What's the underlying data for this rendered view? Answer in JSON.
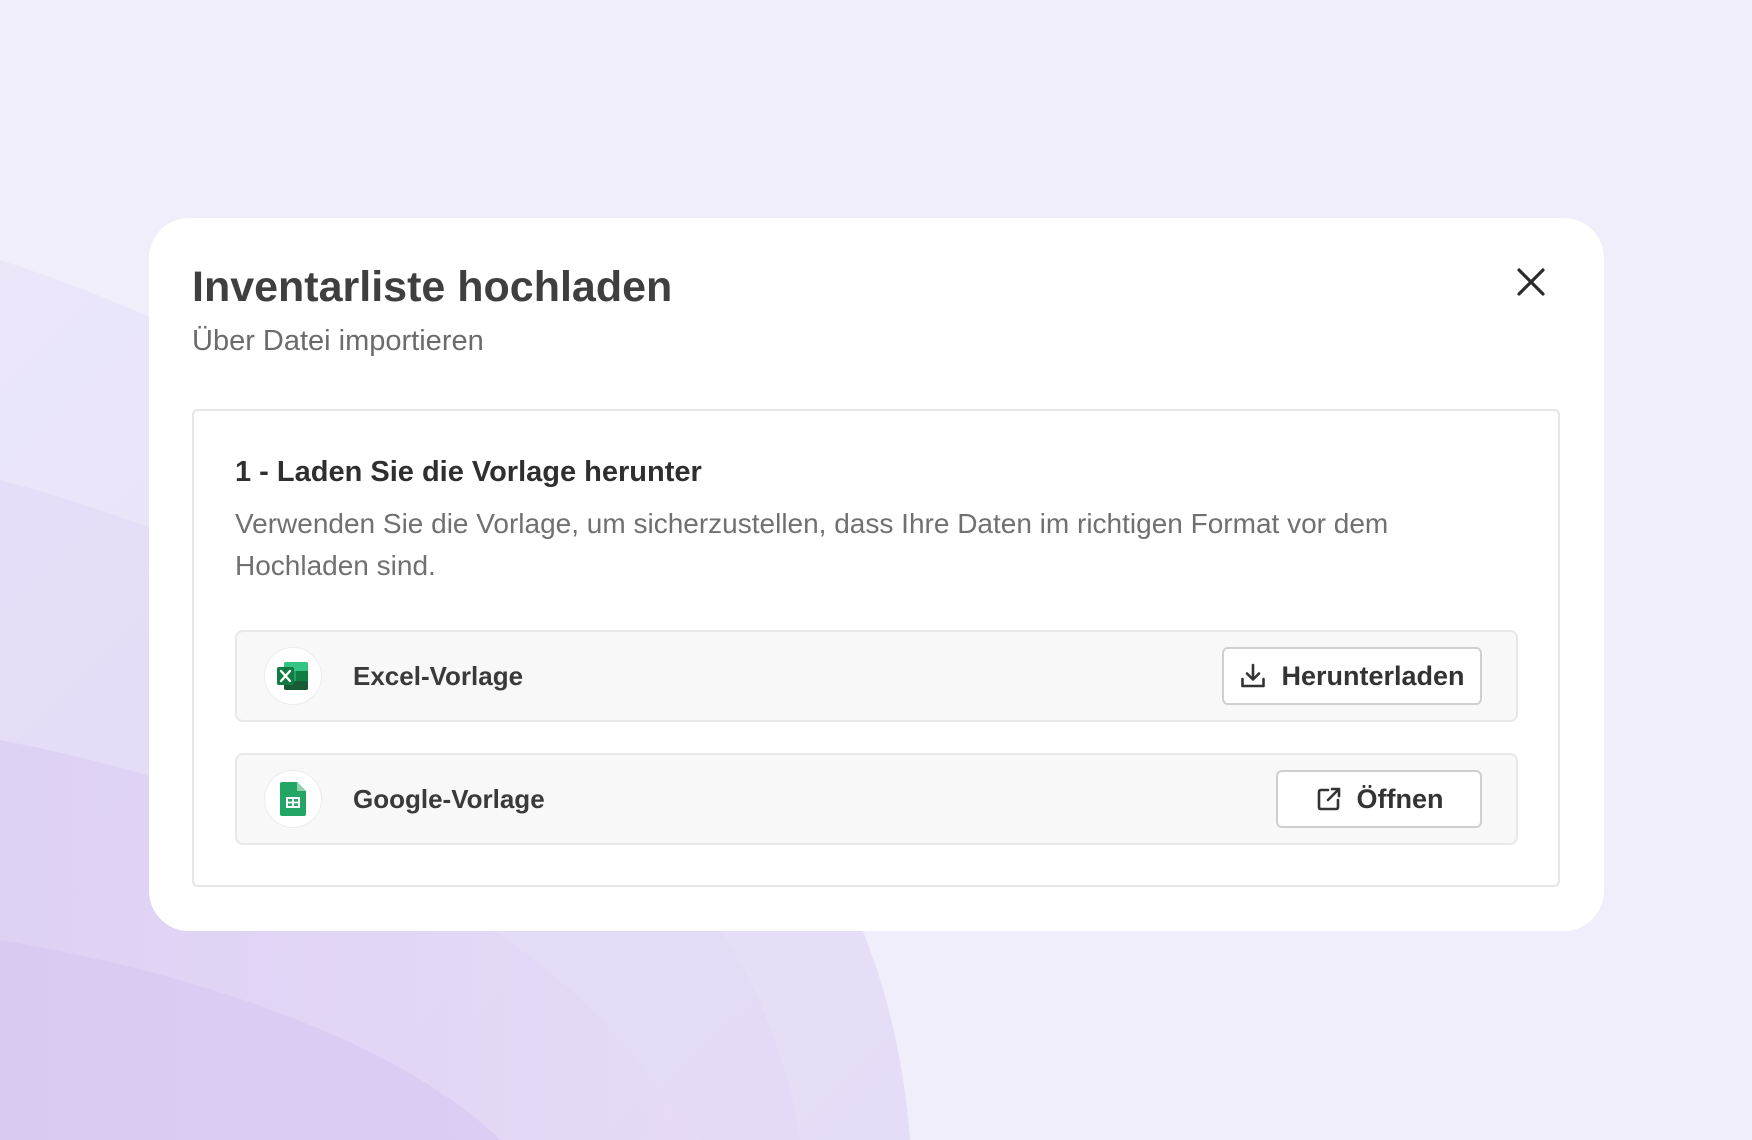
{
  "colors": {
    "background": "#efedfa",
    "background_accent": "#d9c9f3",
    "excel_green": "#1d6f42",
    "sheets_green": "#23a566",
    "title_text": "#3f3f3f",
    "muted_text": "#707070"
  },
  "modal": {
    "title": "Inventarliste hochladen",
    "subtitle": "Über Datei importieren",
    "close_icon": "close-icon"
  },
  "step": {
    "title": "1 - Laden Sie die Vorlage herunter",
    "description": "Verwenden Sie die Vorlage, um sicherzustellen, dass Ihre Daten im richtigen Format vor dem Hochladen sind."
  },
  "templates": [
    {
      "label": "Excel-Vorlage",
      "icon": "excel-icon",
      "button_label": "Herunterladen",
      "button_icon": "download-icon"
    },
    {
      "label": "Google-Vorlage",
      "icon": "google-sheets-icon",
      "button_label": "Öffnen",
      "button_icon": "external-link-icon"
    }
  ]
}
